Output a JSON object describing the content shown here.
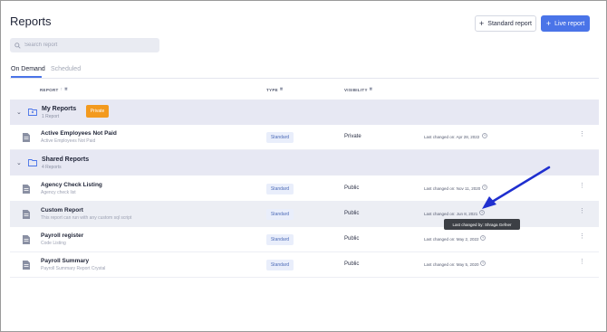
{
  "page": {
    "title": "Reports",
    "standard_report_label": "Standard report",
    "live_report_label": "Live report"
  },
  "search": {
    "placeholder": "Search report"
  },
  "tabs": [
    {
      "label": "On Demand",
      "active": true
    },
    {
      "label": "Scheduled",
      "active": false
    }
  ],
  "columns": {
    "report": "REPORT",
    "type": "TYPE",
    "visibility": "VISIBILITY"
  },
  "groups": [
    {
      "name": "My Reports",
      "count": "1 Report",
      "badge": "Private"
    },
    {
      "name": "Shared Reports",
      "count": "4 Reports"
    }
  ],
  "rows": [
    {
      "name": "Active Employees Not Paid",
      "description": "Active Employees Not Paid",
      "type": "Standard",
      "visibility": "Private",
      "changed": "Last changed on: Apr 28, 2022"
    },
    {
      "name": "Agency Check Listing",
      "description": "Agency check list",
      "type": "Standard",
      "visibility": "Public",
      "changed": "Last changed on: Nov 11, 2020"
    },
    {
      "name": "Custom Report",
      "description": "This report can run with any custom sql script",
      "type": "Standard",
      "visibility": "Public",
      "changed": "Last changed on: Jun 8, 2021"
    },
    {
      "name": "Payroll register",
      "description": "Code Listing",
      "type": "Standard",
      "visibility": "Public",
      "changed": "Last changed on: May 2, 2022"
    },
    {
      "name": "Payroll Summary",
      "description": "Payroll Summary Report Crystal",
      "type": "Standard",
      "visibility": "Public",
      "changed": "Last changed on: May 5, 2020"
    }
  ],
  "tooltip": "Last changed by: Shraga Gefner",
  "colors": {
    "accent": "#4a74e8",
    "private_badge": "#f39a1e",
    "group_bg": "#e7e8f3",
    "annotation_arrow": "#1f2fcf"
  }
}
